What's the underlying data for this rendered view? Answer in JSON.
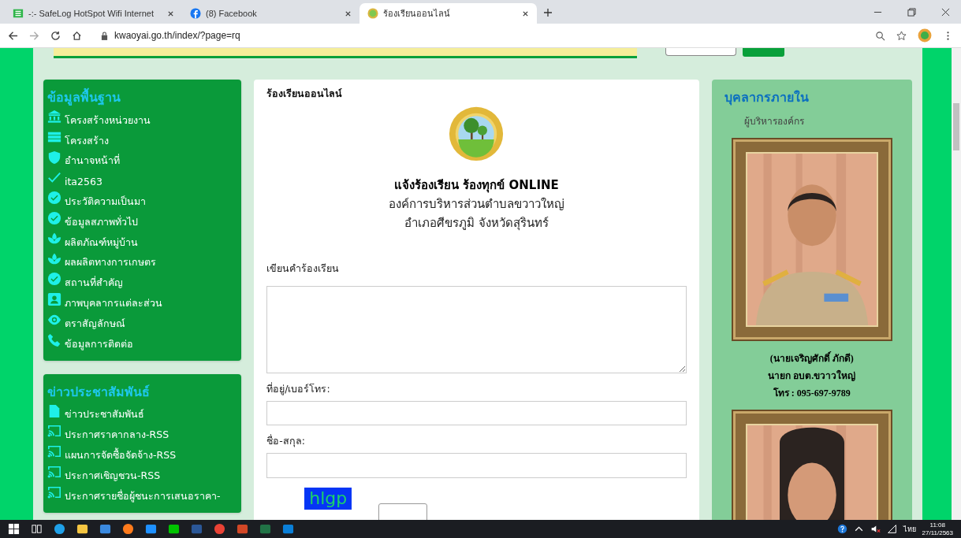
{
  "browser": {
    "tabs": [
      {
        "title": "-:- SafeLog HotSpot Wifi Internet",
        "selected": false
      },
      {
        "title": "(8) Facebook",
        "selected": false
      },
      {
        "title": "ร้องเรียนออนไลน์",
        "selected": true
      }
    ],
    "url": "kwaoyai.go.th/index/?page=rq"
  },
  "sidebar": [
    {
      "title": "ข้อมูลพื้นฐาน",
      "items": [
        {
          "label": "โครงสร้างหน่วยงาน",
          "kind": "bank"
        },
        {
          "label": "โครงสร้าง",
          "kind": "list"
        },
        {
          "label": "อำนาจหน้าที่",
          "kind": "shield"
        },
        {
          "label": "ita2563",
          "kind": "check"
        },
        {
          "label": "ประวัติความเป็นมา",
          "kind": "done"
        },
        {
          "label": "ข้อมูลสภาพทั่วไป",
          "kind": "done"
        },
        {
          "label": "ผลิตภัณฑ์หมู่บ้าน",
          "kind": "lotus"
        },
        {
          "label": "ผลผลิตทางการเกษตร",
          "kind": "lotus"
        },
        {
          "label": "สถานที่สำคัญ",
          "kind": "done"
        },
        {
          "label": "ภาพบุคลากรแต่ละส่วน",
          "kind": "person"
        },
        {
          "label": "ตราสัญลักษณ์",
          "kind": "eye"
        },
        {
          "label": "ข้อมูลการติดต่อ",
          "kind": "phone"
        }
      ]
    },
    {
      "title": "ข่าวประชาสัมพันธ์",
      "items": [
        {
          "label": "ข่าวประชาสัมพันธ์",
          "kind": "file"
        },
        {
          "label": "ประกาศราคากลาง-RSS",
          "kind": "rss"
        },
        {
          "label": "แผนการจัดซื้อจัดจ้าง-RSS",
          "kind": "rss"
        },
        {
          "label": "ประกาศเชิญชวน-RSS",
          "kind": "rss"
        },
        {
          "label": "ประกาศรายชื่อผู้ชนะการเสนอราคา-",
          "kind": "rss"
        }
      ]
    }
  ],
  "form": {
    "title": "ร้องเรียนออนไลน์",
    "heading": "แจ้งร้องเรียน ร้องทุกข์ ONLINE",
    "org": "องค์การบริหารส่วนตำบลขวาวใหญ่",
    "district": "อำเภอศีขรภูมิ จังหวัดสุรินทร์",
    "fields": [
      {
        "label": "เขียนคำร้องเรียน",
        "kind": "textarea"
      },
      {
        "label": "ที่อยู่/เบอร์โทร:",
        "kind": "input"
      },
      {
        "label": "ชื่อ-สกุล:",
        "kind": "input"
      }
    ],
    "captcha": "hlgp"
  },
  "staff": {
    "title": "บุคลากรภายใน",
    "group": "ผู้บริหารองค์กร",
    "people": [
      {
        "kind": "picture",
        "name": "(นายเจริญศักดิ์ ภักดี)",
        "position": "นายก อบต.ขวาวใหญ่",
        "phone": "โทร : 095-697-9789"
      },
      {
        "kind": "picture"
      }
    ]
  },
  "taskbar": {
    "language": "ไทย",
    "time": "11:08",
    "date": "27/11/2563"
  }
}
